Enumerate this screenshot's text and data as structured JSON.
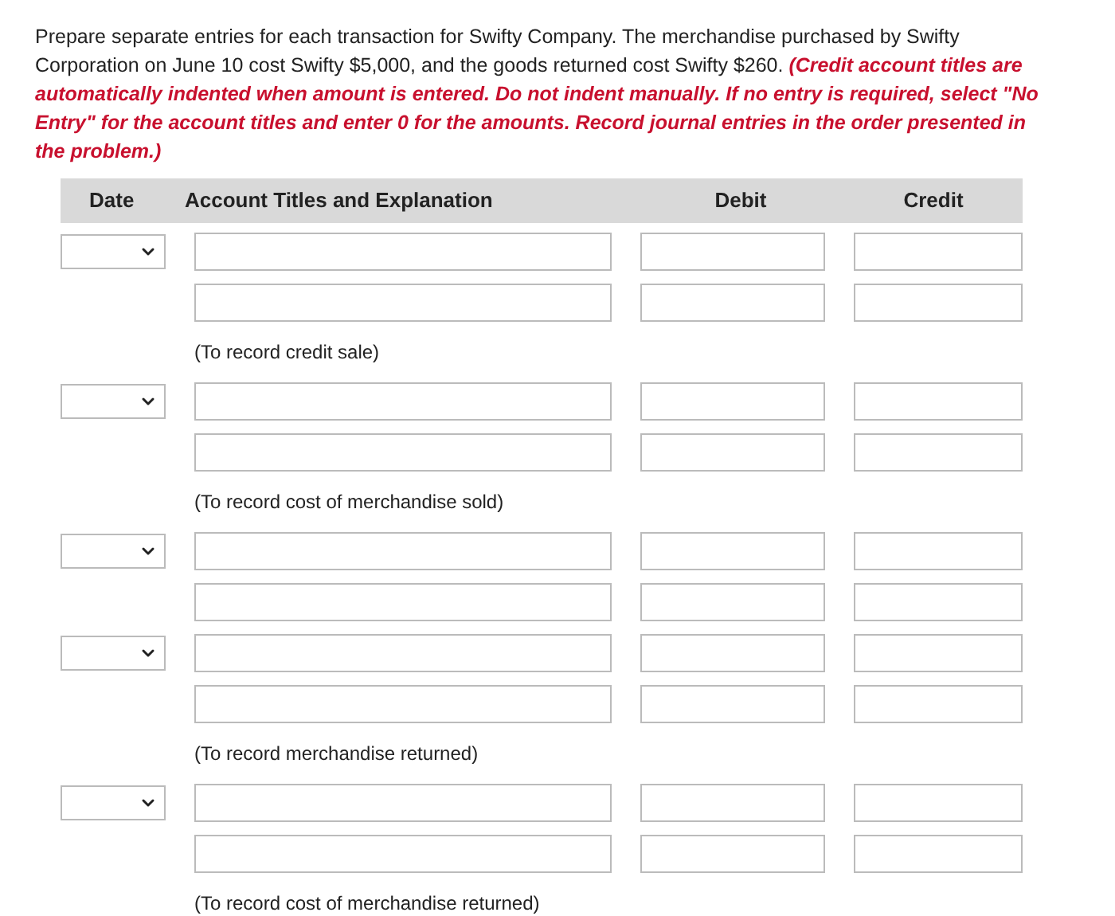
{
  "instructions": "Prepare separate entries for each transaction for Swifty Company. The merchandise purchased by Swifty Corporation on June 10 cost Swifty $5,000, and the goods returned cost Swifty $260. *(Credit account titles are automatically indented when amount is entered. Do not indent manually. If no entry is required, select \"No Entry\" for the account titles and enter 0 for the amounts. Record journal entries in the order presented in the problem.)*",
  "table": {
    "columns": [
      "Date",
      "Account Titles and Explanation",
      "Debit",
      "Credit"
    ],
    "entries": [
      {
        "rows": [
          {
            "date_select": true
          },
          {
            "date_select": false
          }
        ],
        "explanation": "(To record credit sale)"
      },
      {
        "rows": [
          {
            "date_select": true
          },
          {
            "date_select": false
          }
        ],
        "explanation": "(To record cost of merchandise sold)"
      },
      {
        "rows": [
          {
            "date_select": true
          },
          {
            "date_select": false
          },
          {
            "date_select": true
          },
          {
            "date_select": false
          }
        ],
        "explanation": "(To record merchandise returned)"
      },
      {
        "rows": [
          {
            "date_select": true
          },
          {
            "date_select": false
          }
        ],
        "explanation": "(To record cost of merchandise returned)"
      }
    ]
  }
}
